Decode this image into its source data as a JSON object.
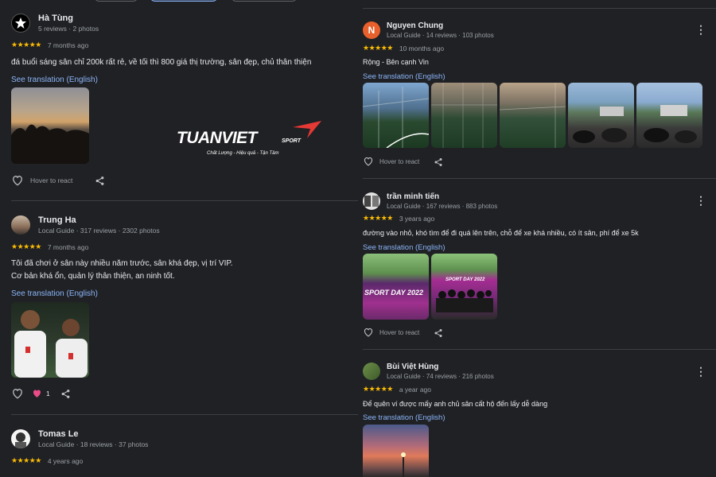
{
  "overlay_logo": {
    "brand": "TUANVIET",
    "brand_suffix": "SPORT",
    "tagline": "Chất Lượng - Hiệu quả - Tận Tâm"
  },
  "colors": {
    "background": "#202124",
    "link": "#8ab4f8",
    "star": "#fbbc04",
    "heart": "#ea4c89",
    "logo_red": "#e53935"
  },
  "left": {
    "reviews": [
      {
        "name": "Hà Tùng",
        "meta": "5 reviews · 2 photos",
        "stars": "★★★★★",
        "time": "7 months ago",
        "text_lines": [
          "đá buổi sáng sân chỉ 200k rất rẻ, về tối thì 800 giá thị trường, sân đẹp, chủ thân thiện"
        ],
        "translation": "See translation (English)",
        "react_label": "Hover to react"
      },
      {
        "name": "Trung Ha",
        "meta": "Local Guide · 317 reviews · 2302 photos",
        "stars": "★★★★★",
        "time": "7 months ago",
        "text_lines": [
          "Tôi đã chơi ở sân này nhiều năm trước, sân khá đẹp, vị trí VIP.",
          "Cơ bản khá ổn, quản lý thân thiện, an ninh tốt."
        ],
        "translation": "See translation (English)",
        "heart_count": "1"
      },
      {
        "name": "Tomas Le",
        "meta": "Local Guide · 18 reviews · 37 photos",
        "stars": "★★★★★",
        "time": "4 years ago"
      }
    ]
  },
  "right": {
    "reviews": [
      {
        "name": "Nguyen Chung",
        "avatar_letter": "N",
        "meta": "Local Guide · 14 reviews · 103 photos",
        "stars": "★★★★★",
        "time": "10 months ago",
        "text_lines": [
          "Rộng - Bên cạnh Vin"
        ],
        "translation": "See translation (English)",
        "react_label": "Hover to react"
      },
      {
        "name": "trần minh tiến",
        "meta": "Local Guide · 167 reviews · 883 photos",
        "stars": "★★★★★",
        "time": "3 years ago",
        "text_lines": [
          "đường vào nhỏ, khó tìm để đi quá lên trên, chỗ để xe khá nhiều, có ít sân, phí để xe 5k"
        ],
        "translation": "See translation (English)",
        "photo_caption": "SPORT DAY 2022",
        "react_label": "Hover to react"
      },
      {
        "name": "Bùi Việt Hùng",
        "meta": "Local Guide · 74 reviews · 216 photos",
        "stars": "★★★★★",
        "time": "a year ago",
        "text_lines": [
          "Để quên ví được mấy anh chủ sân cất hộ đến lấy dễ dàng"
        ],
        "translation": "See translation (English)"
      }
    ]
  }
}
